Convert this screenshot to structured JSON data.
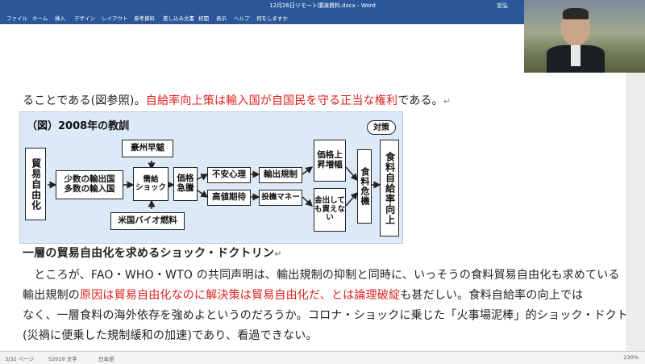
{
  "titlebar": {
    "title": "12月26日リモート講演資料.docx - Word",
    "user": "宣弘",
    "controls": "—  ☐  ✕"
  },
  "menu": [
    "ファイル",
    "ホーム",
    "挿入",
    "デザイン",
    "レイアウト",
    "参考資料",
    "差し込み文書",
    "校閲",
    "表示",
    "ヘルプ",
    "何をしますか"
  ],
  "doc": {
    "line1_pre": "ることである(図参照)。",
    "line1_red": "自給率向上策は輸入国が自国民を守る正当な権利",
    "line1_post": "である。",
    "heading": "一層の貿易自由化を求めるショック・ドクトリン",
    "p1": "　ところが、FAO・WHO・WTO の共同声明は、輸出規制の抑制と同時に、いっそうの食料貿易自由化も求めている",
    "p2_pre": "輸出規制の",
    "p2_red": "原因は貿易自由化なのに解決策は貿易自由化だ、とは論理破綻",
    "p2_post": "も甚だしい。食料自給率の向上では",
    "p3": "なく、一層食料の海外依存を強めよというのだろうか。コロナ・ショックに乗じた「火事場泥棒」的ショック・ドクトリン",
    "p4": "(災禍に便乗した規制緩和の加速)であり、看過できない。"
  },
  "figure": {
    "title": "（図）2008年の教訓",
    "taisaku": "対策",
    "boeki": "貿易自由化",
    "shosu": "少数の輸出国\n多数の輸入国",
    "goshu": "豪州早魃",
    "beikoku": "米国バイオ燃料",
    "jukyu": "需給\nショック",
    "kakaku": "価格\n急騰",
    "fuan": "不安心理",
    "kochi": "高値期待",
    "yushutsu": "輸出規制",
    "toki": "投機マネー",
    "kakakujosho": "価格上昇増幅",
    "kanegashi": "金出しても買えない",
    "shokuryo": "食料危機",
    "jikyu": "食料自給率向上"
  },
  "status": {
    "page": "3/32 ページ",
    "words": "52019 文字",
    "lang": "日本語",
    "zoom": "230%"
  }
}
